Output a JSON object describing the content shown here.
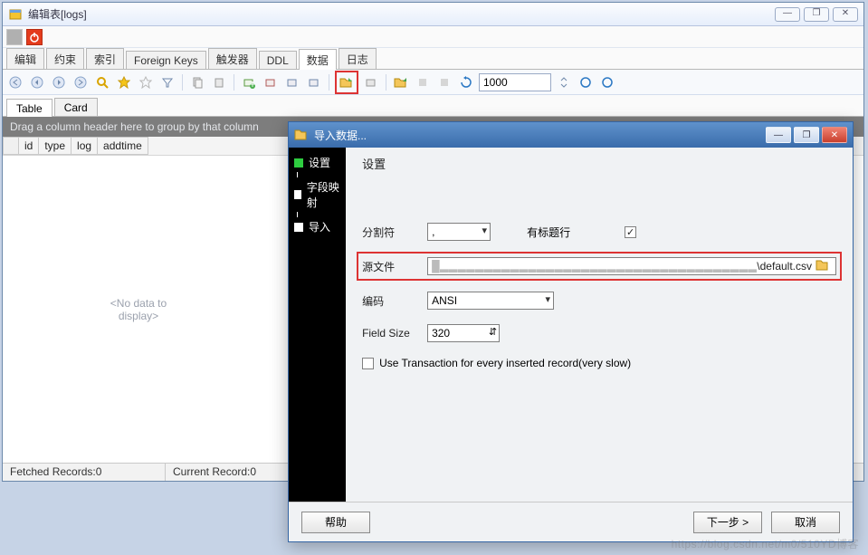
{
  "main": {
    "title": "编辑表[logs]",
    "winbtns": {
      "min": "—",
      "max": "❐",
      "close": "✕"
    },
    "tabs": [
      {
        "label": "编辑"
      },
      {
        "label": "约束"
      },
      {
        "label": "索引"
      },
      {
        "label": "Foreign Keys"
      },
      {
        "label": "触发器"
      },
      {
        "label": "DDL"
      },
      {
        "label": "数据",
        "active": true
      },
      {
        "label": "日志"
      }
    ],
    "toolbar": {
      "rows_value": "1000"
    },
    "viewtabs": [
      {
        "label": "Table",
        "active": true
      },
      {
        "label": "Card"
      }
    ],
    "group_hint": "Drag a column header here to group by that column",
    "columns": [
      "id",
      "type",
      "log",
      "addtime"
    ],
    "empty_msg_1": "<No data to",
    "empty_msg_2": "display>",
    "status": {
      "fetched": "Fetched Records:0",
      "current": "Current Record:0"
    }
  },
  "dialog": {
    "title": "导入数据...",
    "winbtns": {
      "min": "—",
      "max": "❐",
      "close": "✕"
    },
    "nav": [
      {
        "label": "设置",
        "active": true
      },
      {
        "label": "字段映射"
      },
      {
        "label": "导入"
      }
    ],
    "heading": "设置",
    "fields": {
      "sep_label": "分割符",
      "sep_value": ",",
      "header_label": "有标题行",
      "header_checked": true,
      "src_label": "源文件",
      "src_value_visible": "\\default.csv",
      "enc_label": "编码",
      "enc_value": "ANSI",
      "size_label": "Field Size",
      "size_value": "320",
      "txn_label": "Use Transaction for every inserted record(very slow)",
      "txn_checked": false
    },
    "buttons": {
      "help": "帮助",
      "next": "下一步 >",
      "cancel": "取消"
    }
  },
  "watermark": "https://blog.csdn.net/m0/510YD博客"
}
